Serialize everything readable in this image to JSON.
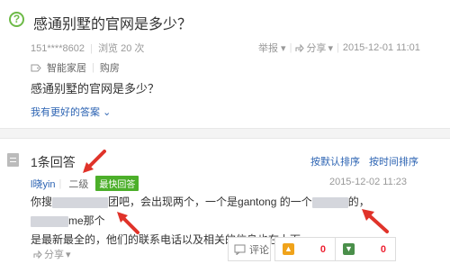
{
  "question": {
    "title": "感通别墅的官网是多少？",
    "user": "151****8602",
    "views": "浏览 20 次",
    "report": "举报",
    "share": "分享",
    "date": "2015-12-01 11:01",
    "tags": [
      "智能家居",
      "购房"
    ],
    "body": "感通别墅的官网是多少？",
    "better_answer": "我有更好的答案"
  },
  "answers": {
    "count_label": "1条回答",
    "sort_default": "按默认排序",
    "sort_time": "按时间排序",
    "user": "l晓yin",
    "level": "二级",
    "badge": "最快回答",
    "date": "2015-12-02 11:23",
    "text_line1_a": "你搜",
    "text_line1_b": "团吧，会出现两个，一个是gantong 的一个",
    "text_line1_c": "的，",
    "text_line1_d": "me那个",
    "text_line2": "是最新最全的，他们的联系电话以及相关的信息也在上面。",
    "share": "分享",
    "comment": "评论",
    "up_count": "0",
    "down_count": "0"
  },
  "colors": {
    "accent_green": "#6dba47",
    "link_blue": "#2d64b3",
    "badge_green": "#4caf2a",
    "arrow_red": "#e0332a"
  },
  "icons": [
    "question-icon",
    "tag-icon",
    "chevron-down-icon",
    "document-icon",
    "share-icon",
    "comment-icon",
    "thumb-up-icon",
    "thumb-down-icon",
    "red-arrow"
  ]
}
